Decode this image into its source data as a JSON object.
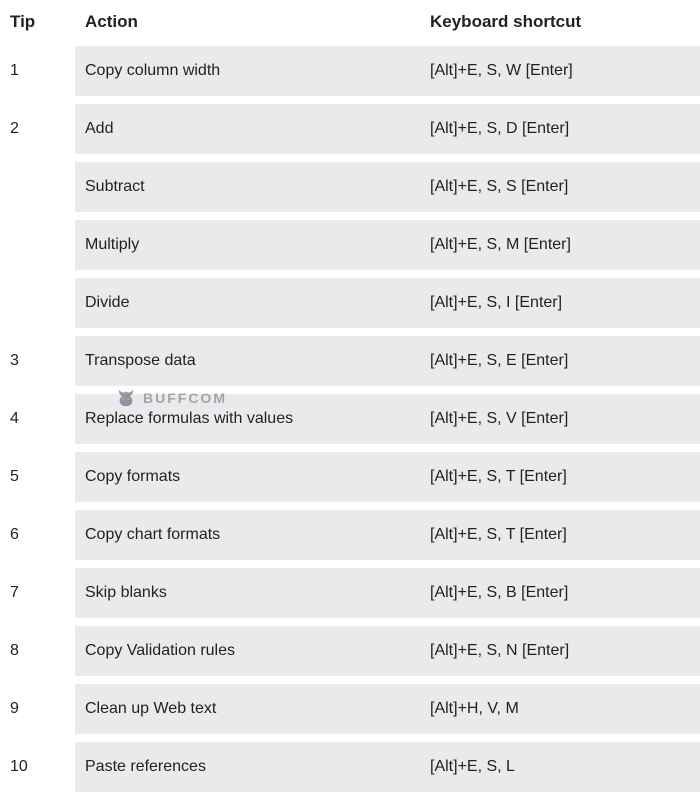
{
  "headers": {
    "tip": "Tip",
    "action": "Action",
    "shortcut": "Keyboard shortcut"
  },
  "rows": [
    {
      "tip": "1",
      "action": "Copy column width",
      "shortcut": "[Alt]+E, S, W [Enter]"
    },
    {
      "tip": "2",
      "action": "Add",
      "shortcut": "[Alt]+E, S, D [Enter]"
    },
    {
      "tip": "",
      "action": "Subtract",
      "shortcut": "[Alt]+E, S, S [Enter]"
    },
    {
      "tip": "",
      "action": "Multiply",
      "shortcut": "[Alt]+E, S, M [Enter]"
    },
    {
      "tip": "",
      "action": "Divide",
      "shortcut": "[Alt]+E, S, I [Enter]"
    },
    {
      "tip": "3",
      "action": "Transpose data",
      "shortcut": "[Alt]+E, S, E [Enter]"
    },
    {
      "tip": "4",
      "action": "Replace formulas with values",
      "shortcut": "[Alt]+E, S, V [Enter]"
    },
    {
      "tip": "5",
      "action": "Copy formats",
      "shortcut": "[Alt]+E, S, T [Enter]"
    },
    {
      "tip": "6",
      "action": "Copy chart formats",
      "shortcut": "[Alt]+E, S, T [Enter]"
    },
    {
      "tip": "7",
      "action": "Skip blanks",
      "shortcut": "[Alt]+E, S, B [Enter]"
    },
    {
      "tip": "8",
      "action": "Copy Validation rules",
      "shortcut": "[Alt]+E, S, N [Enter]"
    },
    {
      "tip": "9",
      "action": "Clean up Web text",
      "shortcut": "[Alt]+H, V, M"
    },
    {
      "tip": "10",
      "action": "Paste references",
      "shortcut": "[Alt]+E, S, L"
    }
  ],
  "watermark": "BUFFCOM"
}
